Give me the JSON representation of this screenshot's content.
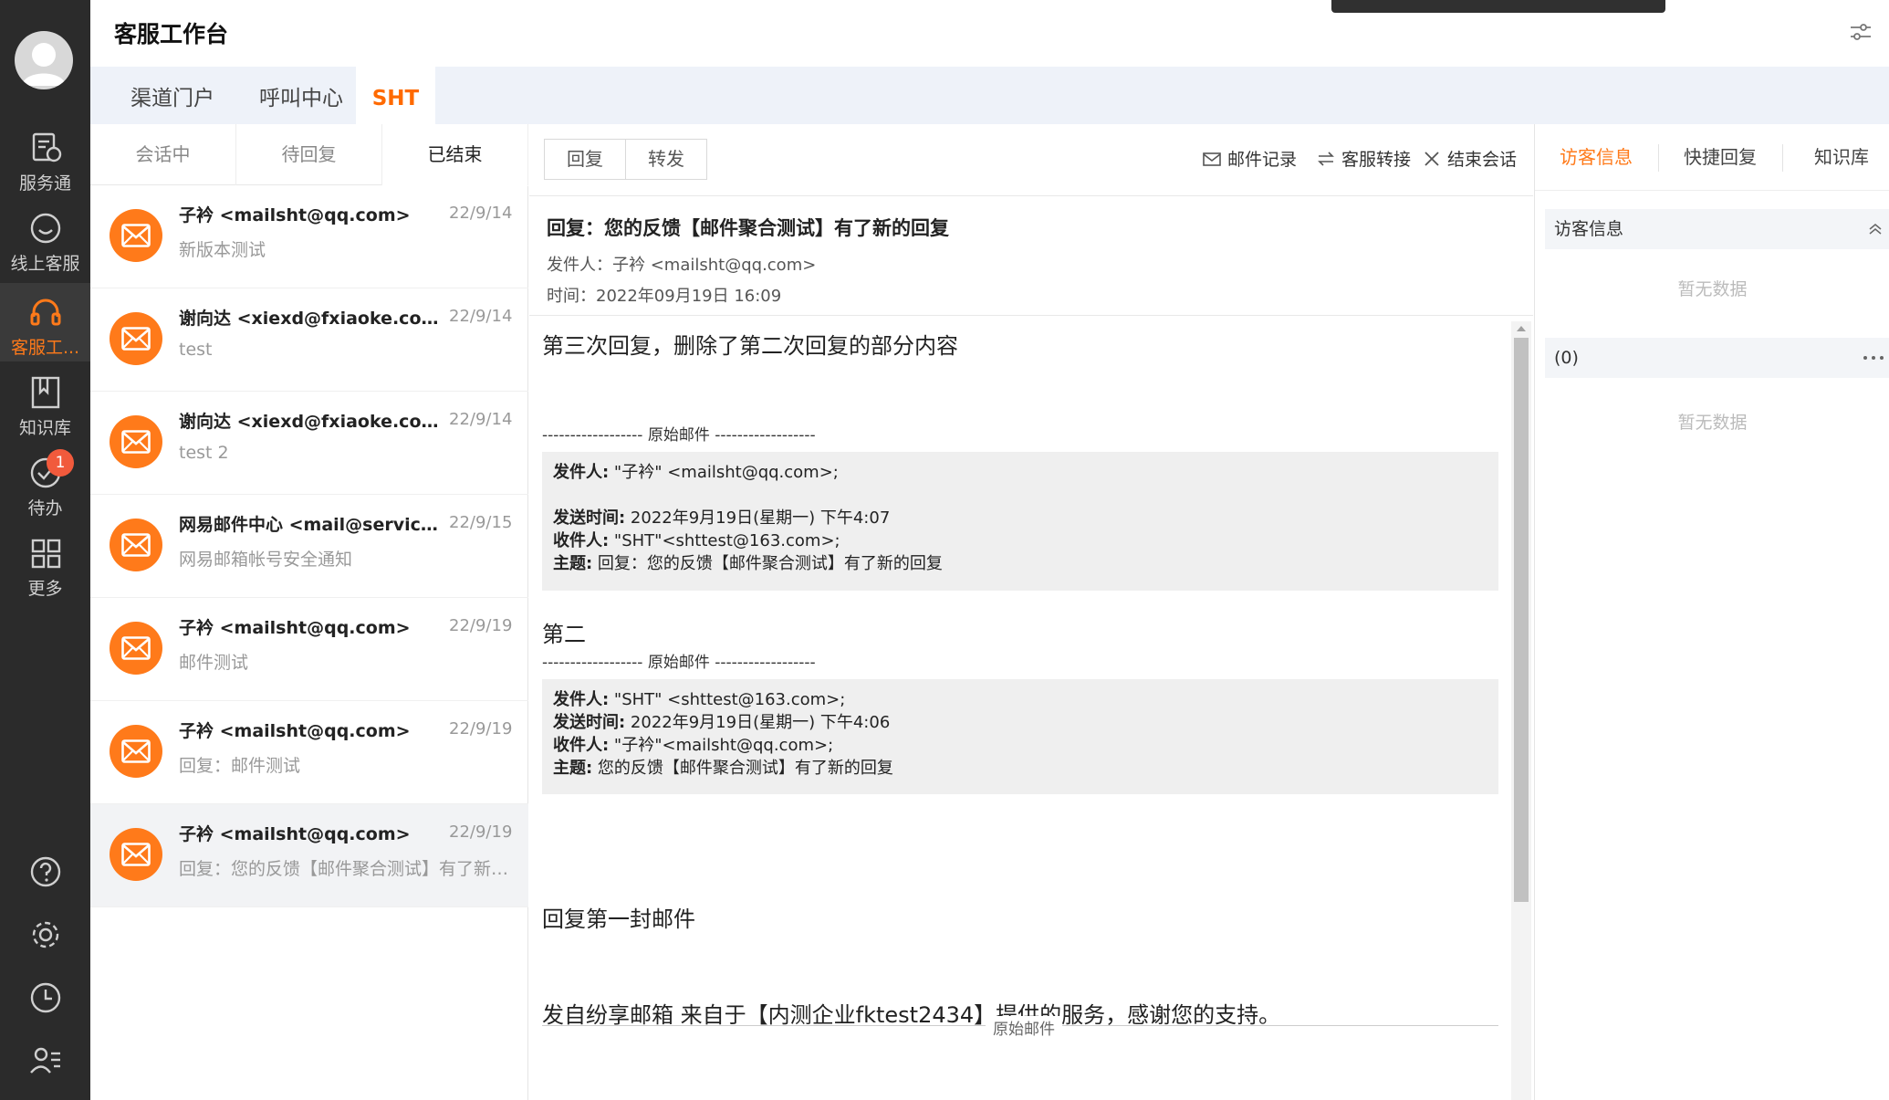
{
  "app": {
    "title": "客服工作台"
  },
  "nav": {
    "items": [
      {
        "label": "服务通"
      },
      {
        "label": "线上客服"
      },
      {
        "label": "客服工..."
      },
      {
        "label": "知识库"
      },
      {
        "label": "待办",
        "badge": "1"
      },
      {
        "label": "更多"
      }
    ],
    "accent_color": "#ff7a1a"
  },
  "top_tabs": [
    {
      "label": "渠道门户"
    },
    {
      "label": "呼叫中心"
    },
    {
      "label": "SHT"
    }
  ],
  "list_tabs": [
    {
      "label": "会话中"
    },
    {
      "label": "待回复"
    },
    {
      "label": "已结束"
    }
  ],
  "conversations": [
    {
      "name": "子衿 <mailsht@qq.com>",
      "date": "22/9/14",
      "preview": "新版本测试"
    },
    {
      "name": "谢向达 <xiexd@fxiaoke.com>",
      "date": "22/9/14",
      "preview": "test"
    },
    {
      "name": "谢向达 <xiexd@fxiaoke.com>",
      "date": "22/9/14",
      "preview": "test 2"
    },
    {
      "name": "网易邮件中心 <mail@service.netease.com>",
      "date": "22/9/15",
      "preview": "网易邮箱帐号安全通知"
    },
    {
      "name": "子衿 <mailsht@qq.com>",
      "date": "22/9/19",
      "preview": "邮件测试"
    },
    {
      "name": "子衿 <mailsht@qq.com>",
      "date": "22/9/19",
      "preview": "回复：邮件测试"
    },
    {
      "name": "子衿 <mailsht@qq.com>",
      "date": "22/9/19",
      "preview": "回复：您的反馈【邮件聚合测试】有了新的回复"
    }
  ],
  "actions": {
    "reply": "回复",
    "forward": "转发",
    "mail_record": "邮件记录",
    "transfer": "客服转接",
    "end": "结束会话"
  },
  "mail": {
    "subject": "回复：您的反馈【邮件聚合测试】有了新的回复",
    "sender": "发件人：子衿 <mailsht@qq.com>",
    "time": "时间：2022年09月19日 16:09",
    "body_line1": "第三次回复，删除了第二次回复的部分内容",
    "orig_header": "------------------ 原始邮件 ------------------",
    "quote1": {
      "from_label": "发件人:",
      "from": " \"子衿\" <mailsht@qq.com>;",
      "sent_label": "发送时间:",
      "sent": " 2022年9月19日(星期一) 下午4:07",
      "to_label": "收件人:",
      "to": " \"SHT\"<shttest@163.com>;",
      "subject_label": "主题:",
      "subject": " 回复：您的反馈【邮件聚合测试】有了新的回复"
    },
    "body_line2": "第二",
    "quote2": {
      "from_label": "发件人:",
      "from": " \"SHT\" <shttest@163.com>;",
      "sent_label": "发送时间:",
      "sent": " 2022年9月19日(星期一) 下午4:06",
      "to_label": "收件人:",
      "to": " \"子衿\"<mailsht@qq.com>;",
      "subject_label": "主题:",
      "subject": " 您的反馈【邮件聚合测试】有了新的回复"
    },
    "body_line3": "回复第一封邮件",
    "body_line4": "发自纷享邮箱 来自于【内测企业fktest2434】提供的服务，感谢您的支持。",
    "bottom_orig": "原始邮件"
  },
  "right": {
    "tabs": [
      {
        "label": "访客信息"
      },
      {
        "label": "快捷回复"
      },
      {
        "label": "知识库"
      }
    ],
    "visitor_panel_title": "访客信息",
    "empty1": "暂无数据",
    "panel2_title": "(0)",
    "empty2": "暂无数据"
  }
}
